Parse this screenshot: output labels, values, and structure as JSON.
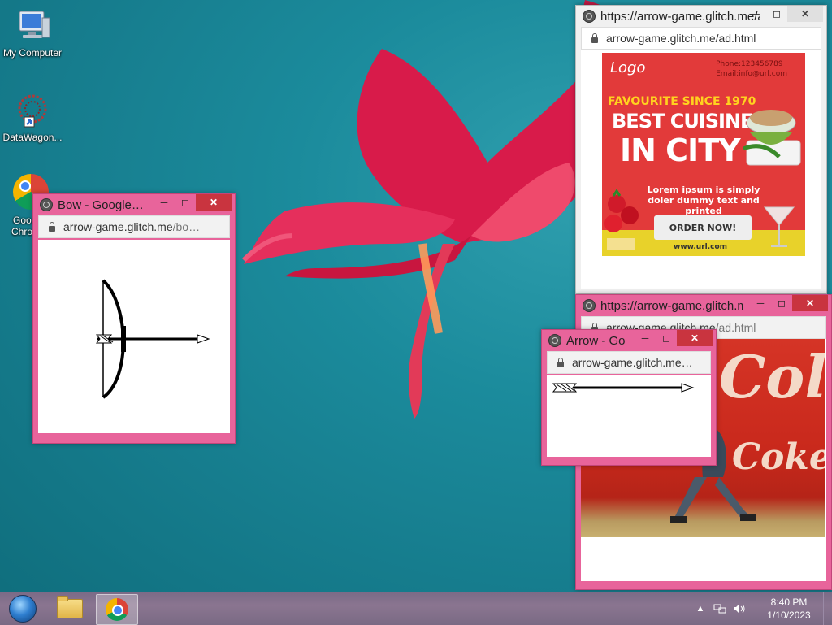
{
  "desktop": {
    "icons": [
      {
        "label": "My Computer"
      },
      {
        "label": "DataWagon..."
      },
      {
        "label_line1": "Goo",
        "label_line2": "Chro"
      }
    ]
  },
  "windows": {
    "ad_top": {
      "title": "https://arrow-game.glitch.me/ad.html",
      "url": "arrow-game.glitch.me/ad.html",
      "ad": {
        "logo": "Logo",
        "phone": "Phone:123456789",
        "email": "Email:info@url.com",
        "tagline": "FAVOURITE SINCE 1970",
        "headline1": "BEST CUISINE",
        "headline2": "IN CITY",
        "body": "Lorem ipsum is simply doler dummy text and printed",
        "cta": "ORDER NOW!",
        "website": "www.url.com"
      }
    },
    "ad_bottom": {
      "title": "https://arrow-game.glitch.me/ad.html",
      "url_host": "arrow-game.glitch.me",
      "url_path": "/ad.html",
      "ad": {
        "word1": "Cola",
        "word2": "Coke"
      }
    },
    "bow": {
      "title": "Bow - Google Chrome",
      "url_host": "arrow-game.glitch.me",
      "url_path": "/bow.html"
    },
    "arrow": {
      "title": "Arrow - Google Chrome",
      "url": "arrow-game.glitch.me/arrow.html"
    }
  },
  "taskbar": {
    "time": "8:40 PM",
    "date": "1/10/2023",
    "tray_arrow": "▲"
  },
  "colors": {
    "window_active_frame": "#e8649b",
    "close_button": "#c9343f",
    "desktop_teal": "#1b8b9c"
  }
}
